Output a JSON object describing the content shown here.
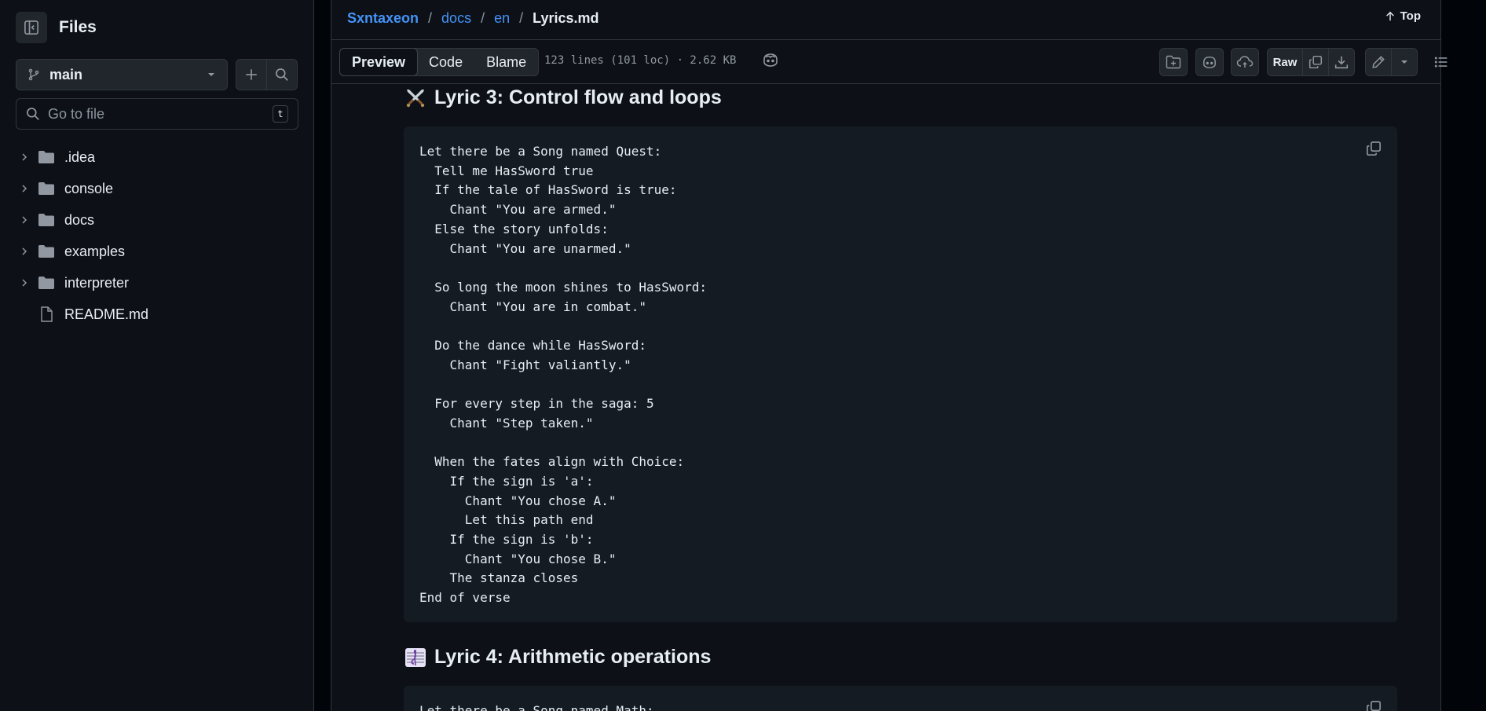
{
  "sidebar": {
    "title": "Files",
    "branch": "main",
    "search_placeholder": "Go to file",
    "search_shortcut": "t",
    "items": [
      {
        "name": ".idea",
        "type": "folder"
      },
      {
        "name": "console",
        "type": "folder"
      },
      {
        "name": "docs",
        "type": "folder"
      },
      {
        "name": "examples",
        "type": "folder"
      },
      {
        "name": "interpreter",
        "type": "folder"
      },
      {
        "name": "README.md",
        "type": "file"
      }
    ]
  },
  "breadcrumb": {
    "repo": "Sxntaxeon",
    "dir1": "docs",
    "dir2": "en",
    "file": "Lyrics.md",
    "separator": "/"
  },
  "top_label": "Top",
  "tabs": {
    "preview": "Preview",
    "code": "Code",
    "blame": "Blame"
  },
  "file_meta": "123 lines (101 loc) · 2.62 KB",
  "toolbar": {
    "raw_label": "Raw"
  },
  "sections": [
    {
      "icon": "crossed-swords-icon",
      "title": "Lyric 3: Control flow and loops",
      "code": "Let there be a Song named Quest:\n  Tell me HasSword true\n  If the tale of HasSword is true:\n    Chant \"You are armed.\"\n  Else the story unfolds:\n    Chant \"You are unarmed.\"\n\n  So long the moon shines to HasSword:\n    Chant \"You are in combat.\"\n\n  Do the dance while HasSword:\n    Chant \"Fight valiantly.\"\n\n  For every step in the saga: 5\n    Chant \"Step taken.\"\n\n  When the fates align with Choice:\n    If the sign is 'a':\n      Chant \"You chose A.\"\n      Let this path end\n    If the sign is 'b':\n      Chant \"You chose B.\"\n    The stanza closes\nEnd of verse"
    },
    {
      "icon": "music-score-icon",
      "title": "Lyric 4: Arithmetic operations",
      "code": "Let there be a Song named Math:"
    }
  ]
}
